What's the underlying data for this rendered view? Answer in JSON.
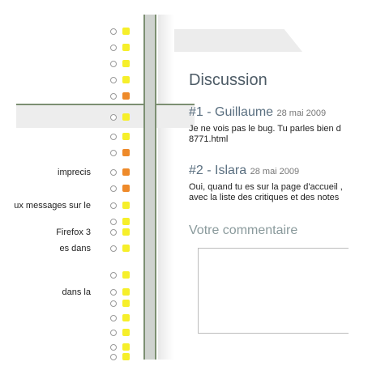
{
  "list": {
    "rows": [
      {
        "text": "",
        "status": "yellow"
      },
      {
        "text": "",
        "status": "yellow"
      },
      {
        "text": "",
        "status": "yellow"
      },
      {
        "text": "",
        "status": "yellow"
      },
      {
        "text": "",
        "status": "orange"
      },
      {
        "text": "",
        "status": "yellow"
      },
      {
        "text": "",
        "status": "yellow"
      },
      {
        "text": "",
        "status": "orange"
      },
      {
        "text": "imprecis",
        "status": "orange"
      },
      {
        "text": "",
        "status": "orange"
      },
      {
        "text": "ux messages sur le",
        "status": "yellow"
      },
      {
        "text": "",
        "status": "yellow"
      },
      {
        "text": "Firefox 3",
        "status": "yellow"
      },
      {
        "text": "es dans",
        "status": "yellow"
      },
      {
        "text": "",
        "status": "yellow"
      },
      {
        "text": "dans la",
        "status": "yellow"
      },
      {
        "text": "",
        "status": "yellow"
      },
      {
        "text": "",
        "status": "yellow"
      },
      {
        "text": "",
        "status": "yellow"
      },
      {
        "text": "",
        "status": "yellow"
      },
      {
        "text": "",
        "status": "yellow"
      }
    ],
    "status_colors": {
      "yellow": "#f6ef2a",
      "orange": "#ee8a2a"
    }
  },
  "discussion": {
    "title": "Discussion",
    "comments": [
      {
        "number": "#1",
        "author": "Guillaume",
        "date": "28 mai 2009",
        "line1": "Je ne vois pas le bug. Tu parles bien d",
        "line2": "8771.html"
      },
      {
        "number": "#2",
        "author": "Islara",
        "date": "28 mai 2009",
        "line1": "Oui, quand tu es sur la page d'accueil ,",
        "line2": "avec la liste des critiques et des notes"
      }
    ],
    "form_title": "Votre commentaire"
  }
}
